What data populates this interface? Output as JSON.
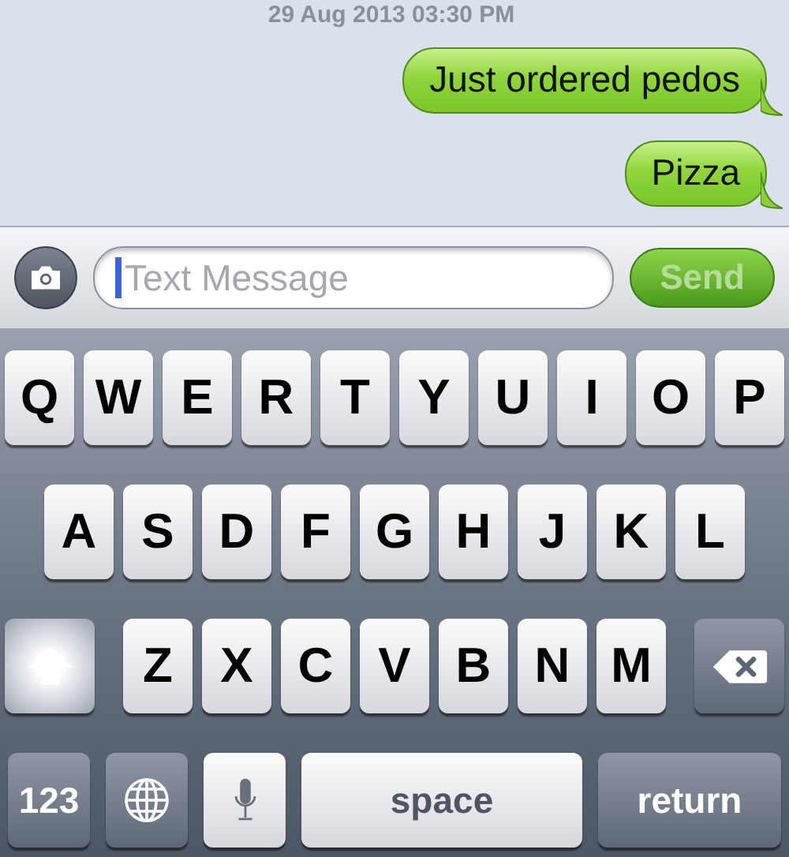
{
  "timestamp": "29 Aug 2013 03:30 PM",
  "messages": [
    {
      "text": "Just ordered pedos"
    },
    {
      "text": "Pizza"
    }
  ],
  "composer": {
    "placeholder": "Text Message",
    "send": {
      "label": "Send",
      "disabled": true
    }
  },
  "keyboard": {
    "rows": [
      [
        "Q",
        "W",
        "E",
        "R",
        "T",
        "Y",
        "U",
        "I",
        "O",
        "P"
      ],
      [
        "A",
        "S",
        "D",
        "F",
        "G",
        "H",
        "J",
        "K",
        "L"
      ],
      [
        "Z",
        "X",
        "C",
        "V",
        "B",
        "N",
        "M"
      ]
    ],
    "shift": {
      "on": true
    },
    "numbers_key": "123",
    "space_key": "space",
    "return_key": "return"
  }
}
